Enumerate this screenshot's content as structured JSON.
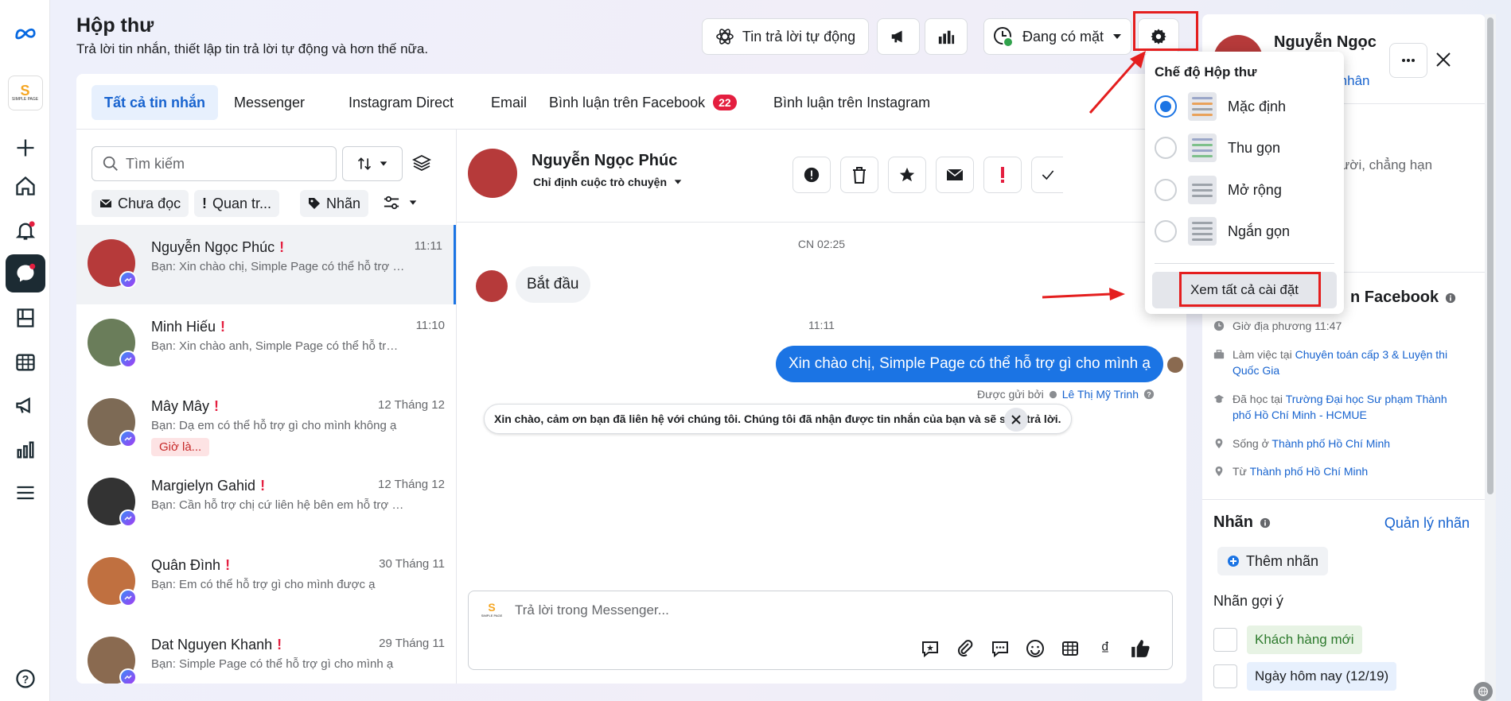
{
  "header": {
    "title": "Hộp thư",
    "subtitle": "Trả lời tin nhắn, thiết lập tin trả lời tự động và hơn thế nữa.",
    "auto_reply_label": "Tin trả lời tự động",
    "status_label": "Đang có mặt"
  },
  "page_logo": {
    "mark": "S",
    "text": "SIMPLE PAGE"
  },
  "tabs": [
    {
      "label": "Tất cả tin nhắn",
      "active": true
    },
    {
      "label": "Messenger"
    },
    {
      "label": "Instagram Direct"
    },
    {
      "label": "Email"
    },
    {
      "label": "Bình luận trên Facebook",
      "badge": "22"
    },
    {
      "label": "Bình luận trên Instagram"
    }
  ],
  "list": {
    "search_placeholder": "Tìm kiếm",
    "filters": [
      "Chưa đọc",
      "Quan tr...",
      "Nhãn"
    ],
    "conversations": [
      {
        "name": "Nguyễn Ngọc Phúc",
        "time": "11:11",
        "preview": "Bạn: Xin chào chị, Simple Page có thể hỗ trợ gì cho mình ạ",
        "color": "#b63a3a"
      },
      {
        "name": "Minh Hiếu",
        "time": "11:10",
        "preview": "Bạn: Xin chào anh, Simple Page có thể hỗ trợ gì cho mình ạ",
        "color": "#6a7d5a"
      },
      {
        "name": "Mây Mây",
        "time": "12 Tháng 12",
        "preview": "Bạn: Dạ em có thể hỗ trợ gì cho mình không ạ",
        "tag": "Giờ là...",
        "color": "#7d6a55"
      },
      {
        "name": "Margielyn Gahid",
        "time": "12 Tháng 12",
        "preview": "Bạn: Cần hỗ trợ chị cứ liên hệ bên em hỗ trợ nhé",
        "color": "#333333"
      },
      {
        "name": "Quân Đình",
        "time": "30 Tháng 11",
        "preview": "Bạn: Em có thể hỗ trợ gì cho mình được ạ",
        "color": "#c07040"
      },
      {
        "name": "Dat Nguyen Khanh",
        "time": "29 Tháng 11",
        "preview": "Bạn: Simple Page có thể hỗ trợ gì cho mình ạ",
        "color": "#8a6a50"
      }
    ]
  },
  "chat": {
    "name": "Nguyễn Ngọc Phúc",
    "assign": "Chỉ định cuộc trò chuyện",
    "day_label": "CN 02:25",
    "incoming": "Bắt đầu",
    "time_label": "11:11",
    "outgoing": "Xin chào chị, Simple Page có thể hỗ trợ gì cho mình ạ",
    "sent_by_prefix": "Được gửi bởi",
    "sent_by": "Lê Thị Mỹ Trinh",
    "auto_reply": "Xin chào, cảm ơn bạn đã liên hệ với chúng tôi. Chúng tôi đã nhận được tin nhắn của bạn và sẽ sớm trả lời.",
    "composer_placeholder": "Trả lời trong Messenger..."
  },
  "right": {
    "name": "Nguyễn Ngọc",
    "profile_link": "cá nhân",
    "hint": "người, chẳng hạn",
    "fb_section": "n Facebook",
    "local_time": "Giờ địa phương 11:47",
    "work_prefix": "Làm việc tại",
    "work": "Chuyên toán cấp 3 & Luyện thi Quốc Gia",
    "study_prefix": "Đã học tại",
    "study": "Trường Đại học Sư phạm Thành phố Hồ Chí Minh - HCMUE",
    "live_prefix": "Sống ở",
    "live": "Thành phố Hồ Chí Minh",
    "from_prefix": "Từ",
    "from": "Thành phố Hồ Chí Minh",
    "labels_title": "Nhãn",
    "manage_labels": "Quản lý nhãn",
    "add_label": "Thêm nhãn",
    "suggest_title": "Nhãn gợi ý",
    "suggest": [
      "Khách hàng mới",
      "Ngày hôm nay (12/19)"
    ]
  },
  "dropdown": {
    "title": "Chế độ Hộp thư",
    "options": [
      {
        "label": "Mặc định",
        "selected": true
      },
      {
        "label": "Thu gọn"
      },
      {
        "label": "Mở rộng"
      },
      {
        "label": "Ngắn gọn"
      }
    ],
    "see_all": "Xem tất cả cài đặt"
  },
  "colors": {
    "accent": "#1b74e4",
    "annotation": "#e41e1e",
    "badge": "#e41e3f"
  }
}
